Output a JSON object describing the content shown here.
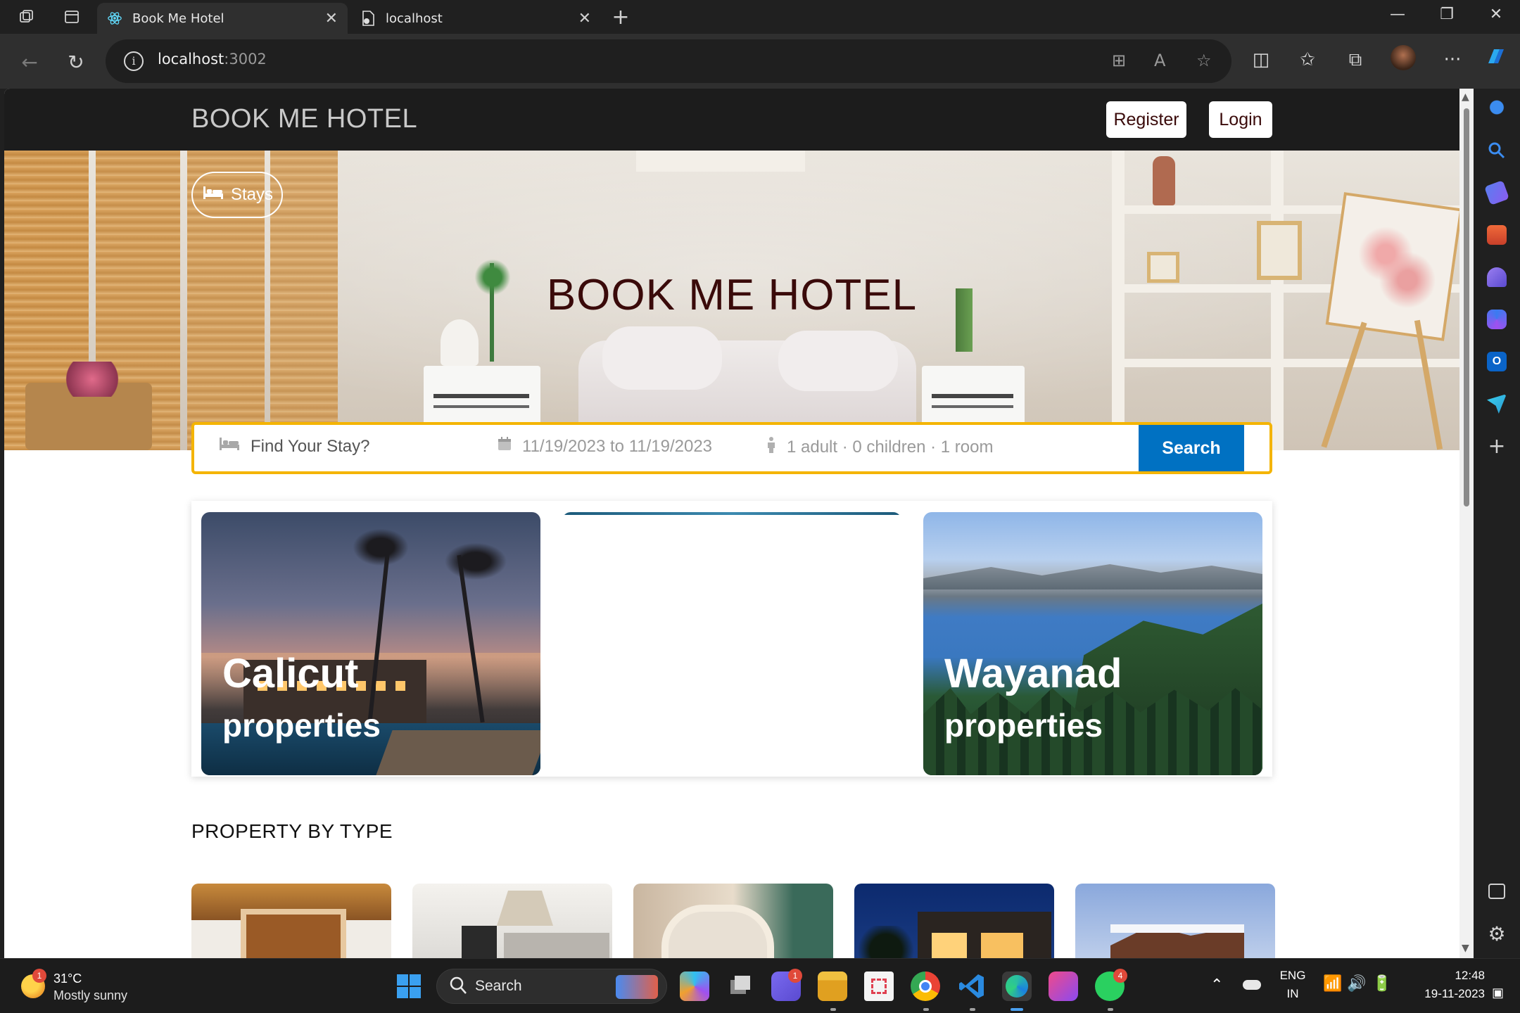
{
  "browser": {
    "tabs": [
      {
        "title": "Book Me Hotel",
        "active": true,
        "favicon": "react-icon"
      },
      {
        "title": "localhost",
        "active": false,
        "favicon": "doc-icon"
      }
    ],
    "url_host": "localhost",
    "url_port": ":3002"
  },
  "site": {
    "logo": "BOOK ME HOTEL",
    "register_label": "Register",
    "login_label": "Login",
    "stays_label": "Stays",
    "hero_title": "BOOK ME HOTEL",
    "search": {
      "destination_placeholder": "Find Your Stay?",
      "dates": "11/19/2023 to 11/19/2023",
      "guests": "1 adult · 0 children · 1 room",
      "button_label": "Search"
    },
    "featured": [
      {
        "city": "Calicut",
        "sub": "properties"
      },
      {
        "city": "",
        "sub": ""
      },
      {
        "city": "Wayanad",
        "sub": "properties"
      }
    ],
    "property_section_title": "PROPERTY BY TYPE"
  },
  "taskbar": {
    "weather_temp": "31°C",
    "weather_desc": "Mostly sunny",
    "weather_badge": "1",
    "search_label": "Search",
    "teams_badge": "1",
    "whatsapp_badge": "4",
    "lang_top": "ENG",
    "lang_bottom": "IN",
    "time": "12:48",
    "date": "19-11-2023"
  },
  "colors": {
    "accent_blue": "#0071c2",
    "search_border": "#f4b400",
    "hero_title": "#3a0a0a"
  }
}
